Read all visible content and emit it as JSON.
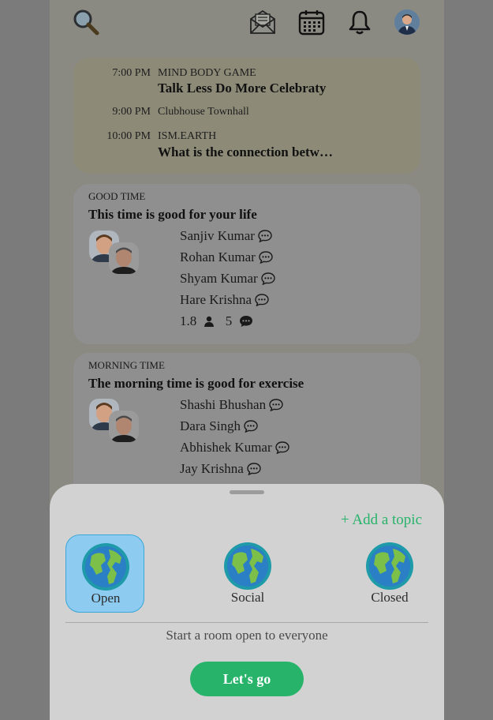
{
  "topbar": {
    "icons": [
      "search-icon",
      "envelope-icon",
      "calendar-icon",
      "bell-icon",
      "avatar"
    ]
  },
  "schedule": [
    {
      "time": "7:00 PM",
      "club": "MIND BODY GAME",
      "title": "Talk Less Do More Celebraty"
    },
    {
      "time": "9:00 PM",
      "club": "Clubhouse Townhall",
      "title": ""
    },
    {
      "time": "10:00 PM",
      "club": "ISM.EARTH",
      "title": "What is the connection betw…"
    }
  ],
  "rooms": [
    {
      "club": "GOOD TIME",
      "title": "This time is good for your life",
      "speakers": [
        "Sanjiv Kumar",
        "Rohan Kumar",
        "Shyam Kumar",
        "Hare Krishna"
      ],
      "listeners": "1.8",
      "speakers_count": "5"
    },
    {
      "club": "MORNING TIME",
      "title": "The morning time is good for exercise",
      "speakers": [
        "Shashi Bhushan",
        "Dara Singh",
        "Abhishek Kumar",
        "Jay Krishna"
      ]
    }
  ],
  "sheet": {
    "add_topic": "+ Add a topic",
    "types": [
      {
        "label": "Open",
        "selected": true
      },
      {
        "label": "Social",
        "selected": false
      },
      {
        "label": "Closed",
        "selected": false
      }
    ],
    "description": "Start a room open to everyone",
    "cta": "Let's go"
  },
  "colors": {
    "accent": "#27b36a",
    "selected_bg": "#8dcbf1",
    "overlay": "#7b7b7b"
  }
}
